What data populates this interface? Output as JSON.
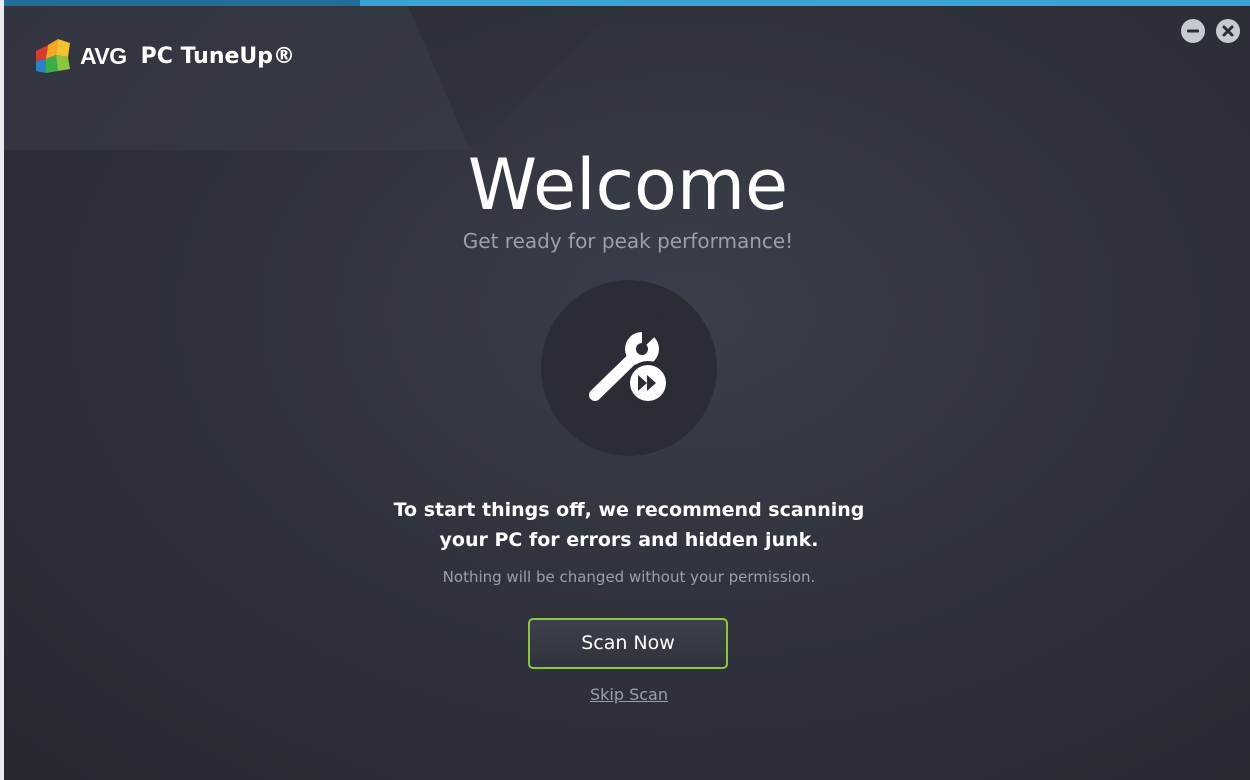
{
  "window": {
    "brand": "AVG",
    "product": "PC TuneUp®",
    "controls": {
      "minimize_icon": "minus-circle-icon",
      "close_icon": "x-circle-icon"
    }
  },
  "hero": {
    "title": "Welcome",
    "subtitle": "Get ready for peak performance!",
    "icon": "wrench-fast-forward-icon"
  },
  "message": {
    "line1": "To start things off, we recommend scanning",
    "line2": "your PC for errors and hidden junk.",
    "note": "Nothing will be changed without your permission."
  },
  "actions": {
    "scan_label": "Scan Now",
    "skip_label": "Skip Scan"
  },
  "colors": {
    "background": "#30333d",
    "accent_green": "#8cc640",
    "top_bar_blue": "#3aa3d6",
    "muted_text": "#9aa0aa"
  }
}
